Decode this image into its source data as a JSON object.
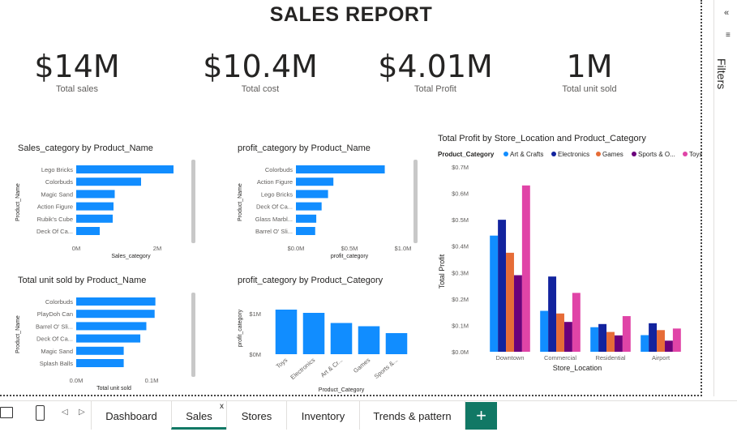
{
  "report": {
    "title": "SALES REPORT"
  },
  "kpis": [
    {
      "value": "$14M",
      "label": "Total sales"
    },
    {
      "value": "$10.4M",
      "label": "Total cost"
    },
    {
      "value": "$4.01M",
      "label": "Total Profit"
    },
    {
      "value": "1M",
      "label": "Total unit sold"
    }
  ],
  "filters": {
    "label": "Filters"
  },
  "tabs": [
    {
      "label": "Dashboard"
    },
    {
      "label": "Sales",
      "close": "x"
    },
    {
      "label": "Stores"
    },
    {
      "label": "Inventory"
    },
    {
      "label": "Trends & pattern"
    }
  ],
  "add_tab": "+",
  "colors": {
    "bar": "#118dff",
    "accent": "#117865"
  },
  "chart_data": [
    {
      "type": "bar",
      "orientation": "horizontal",
      "title": "Sales_category by Product_Name",
      "ylabel": "Product_Name",
      "xlabel": "Sales_category",
      "categories": [
        "Lego Bricks",
        "Colorbuds",
        "Magic Sand",
        "Action Figure",
        "Rubik's Cube",
        "Deck Of Ca..."
      ],
      "values": [
        2.4,
        1.6,
        0.95,
        0.92,
        0.9,
        0.58
      ],
      "value_unit": "M",
      "xticks": [
        "0M",
        "2M"
      ],
      "xlim": [
        0,
        2.7
      ]
    },
    {
      "type": "bar",
      "orientation": "horizontal",
      "title": "profit_category by Product_Name",
      "ylabel": "Product_Name",
      "xlabel": "profit_category",
      "categories": [
        "Colorbuds",
        "Action Figure",
        "Lego Bricks",
        "Deck Of Ca...",
        "Glass Marbl...",
        "Barrel O' Sli..."
      ],
      "values": [
        0.83,
        0.35,
        0.3,
        0.24,
        0.19,
        0.18
      ],
      "value_unit": "M",
      "xticks": [
        "$0.0M",
        "$0.5M",
        "$1.0M"
      ],
      "xlim": [
        0,
        1.0
      ]
    },
    {
      "type": "bar",
      "orientation": "horizontal",
      "title": "Total unit sold by Product_Name",
      "ylabel": "Product_Name",
      "xlabel": "Total unit sold",
      "categories": [
        "Colorbuds",
        "PlayDoh Can",
        "Barrel O' Sli...",
        "Deck Of Ca...",
        "Magic Sand",
        "Splash Balls"
      ],
      "values": [
        0.105,
        0.104,
        0.093,
        0.085,
        0.063,
        0.063
      ],
      "value_unit": "M",
      "xticks": [
        "0.0M",
        "0.1M"
      ],
      "xlim": [
        0,
        0.1
      ]
    },
    {
      "type": "bar",
      "orientation": "vertical",
      "title": "profit_category by Product_Category",
      "ylabel": "profit_category",
      "xlabel": "Product_Category",
      "categories": [
        "Toys",
        "Electronics",
        "Art & Cr...",
        "Games",
        "Sports &..."
      ],
      "values": [
        1.1,
        1.02,
        0.77,
        0.69,
        0.52
      ],
      "value_unit": "M",
      "yticks": [
        "$0M",
        "$1M"
      ],
      "ylim": [
        0,
        1.1
      ]
    },
    {
      "type": "bar",
      "orientation": "vertical",
      "title": "Total Profit by Store_Location and Product_Category",
      "legend_title": "Product_Category",
      "ylabel": "Total Profit",
      "xlabel": "Store_Location",
      "categories": [
        "Downtown",
        "Commercial",
        "Residential",
        "Airport"
      ],
      "series": [
        {
          "name": "Art & Crafts",
          "color": "#118dff",
          "values": [
            0.44,
            0.155,
            0.093,
            0.063
          ]
        },
        {
          "name": "Electronics",
          "color": "#12239e",
          "values": [
            0.5,
            0.285,
            0.105,
            0.108
          ]
        },
        {
          "name": "Games",
          "color": "#e66c37",
          "values": [
            0.375,
            0.145,
            0.075,
            0.082
          ]
        },
        {
          "name": "Sports & O...",
          "color": "#6b007b",
          "values": [
            0.29,
            0.113,
            0.062,
            0.042
          ]
        },
        {
          "name": "Toys",
          "color": "#e044a7",
          "values": [
            0.63,
            0.223,
            0.135,
            0.088
          ]
        }
      ],
      "yticks": [
        "$0.0M",
        "$0.1M",
        "$0.2M",
        "$0.3M",
        "$0.4M",
        "$0.5M",
        "$0.6M",
        "$0.7M"
      ],
      "ylim": [
        0,
        0.7
      ],
      "value_unit": "M"
    }
  ]
}
